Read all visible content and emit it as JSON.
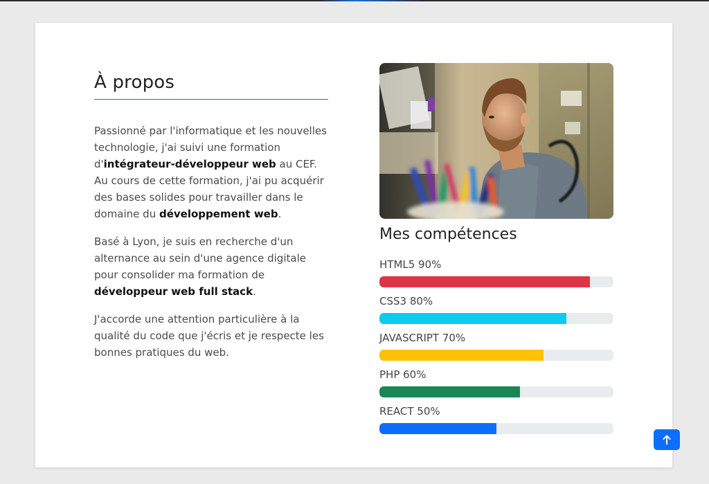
{
  "about": {
    "title": "À propos",
    "p1": [
      {
        "t": "Passionné par l'informatique et les nouvelles technologie, j'ai suivi une formation d'",
        "b": false
      },
      {
        "t": "intégrateur-développeur web",
        "b": true
      },
      {
        "t": " au CEF. Au cours de cette formation, j'ai pu acquérir des bases solides pour travailler dans le domaine du ",
        "b": false
      },
      {
        "t": "développement web",
        "b": true
      },
      {
        "t": ".",
        "b": false
      }
    ],
    "p2": [
      {
        "t": "Basé à Lyon, je suis en recherche d'un alternance au sein d'une agence digitale pour consolider ma formation de ",
        "b": false
      },
      {
        "t": "développeur web full stack",
        "b": true
      },
      {
        "t": ".",
        "b": false
      }
    ],
    "p3": [
      {
        "t": "J'accorde une attention particulière à la qualité du code que j'écris et je respecte les bonnes pratiques du web.",
        "b": false
      }
    ]
  },
  "photo": {
    "alt": "man-working-at-laptop-photo"
  },
  "skills": {
    "title": "Mes compétences",
    "items": [
      {
        "label": "HTML5 90%",
        "percent": 90,
        "color": "#dc3545"
      },
      {
        "label": "CSS3 80%",
        "percent": 80,
        "color": "#0dcaf0"
      },
      {
        "label": "JAVASCRIPT 70%",
        "percent": 70,
        "color": "#ffc107"
      },
      {
        "label": "PHP 60%",
        "percent": 60,
        "color": "#198754"
      },
      {
        "label": "REACT 50%",
        "percent": 50,
        "color": "#0d6efd"
      }
    ]
  },
  "back_to_top": {
    "icon": "arrow-up-icon",
    "color": "#0d6efd"
  }
}
